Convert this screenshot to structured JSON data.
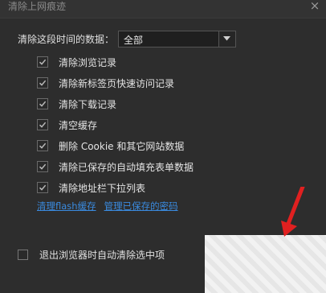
{
  "dialog": {
    "title": "清除上网痕迹",
    "close_glyph": "×"
  },
  "range": {
    "label": "清除这段时间的数据：",
    "selected": "全部"
  },
  "options": [
    {
      "label": "清除浏览记录",
      "checked": true
    },
    {
      "label": "清除新标签页快速访问记录",
      "checked": true
    },
    {
      "label": "清除下载记录",
      "checked": true
    },
    {
      "label": "清空缓存",
      "checked": true
    },
    {
      "label": "删除 Cookie 和其它网站数据",
      "checked": true
    },
    {
      "label": "清除已保存的自动填充表单数据",
      "checked": true
    },
    {
      "label": "清除地址栏下拉列表",
      "checked": true
    }
  ],
  "links": {
    "flash": "清理flash缓存",
    "passwords": "管理已保存的密码"
  },
  "auto_clear": {
    "label": "退出浏览器时自动清除选中项",
    "checked": false
  },
  "colors": {
    "background": "#2d2d2d",
    "link": "#3a8be0",
    "arrow": "#e02020"
  },
  "icons": {
    "close": "close-icon",
    "dropdown": "chevron-down-icon",
    "check": "check-icon"
  }
}
